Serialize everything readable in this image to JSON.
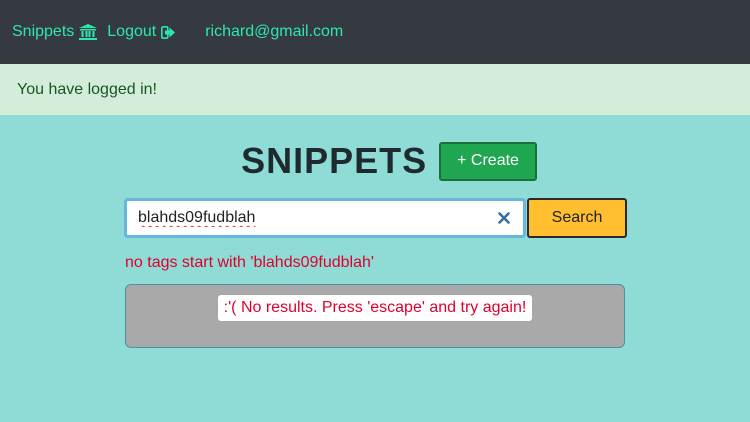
{
  "navbar": {
    "snippets_label": "Snippets",
    "logout_label": "Logout",
    "user_email": "richard@gmail.com",
    "link_color": "#2ee6b0",
    "background": "#343a40"
  },
  "alert": {
    "message": "You have logged in!"
  },
  "main": {
    "title": "SNIPPETS",
    "create_label": "+ Create",
    "search": {
      "value": "blahds09fudblah",
      "button_label": "Search"
    },
    "error_message": "no tags start with 'blahds09fudblah'",
    "no_results_message": ":'( No results. Press 'escape' and try again!"
  },
  "icons": {
    "snippets": "bank-icon",
    "logout": "sign-out-icon",
    "clear": "close-icon"
  }
}
